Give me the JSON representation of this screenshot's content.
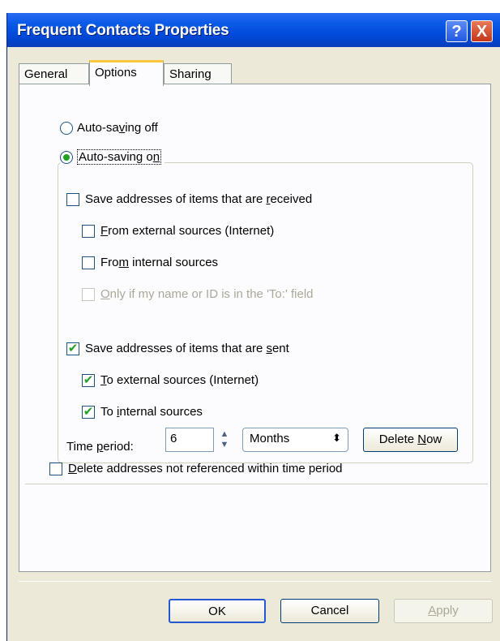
{
  "window": {
    "title": "Frequent Contacts Properties",
    "help_glyph": "?",
    "close_glyph": "X"
  },
  "tabs": [
    {
      "label": "General",
      "active": false
    },
    {
      "label": "Options",
      "active": true
    },
    {
      "label": "Sharing",
      "active": false
    }
  ],
  "options": {
    "auto_off": {
      "pre": "Auto-sa",
      "key": "v",
      "post": "ing off",
      "selected": false
    },
    "auto_on": {
      "pre": "Auto-saving o",
      "key": "n",
      "post": "",
      "selected": true
    },
    "received": {
      "pre": "Save addresses of items that are ",
      "key": "r",
      "post": "eceived",
      "checked": false
    },
    "recv_external": {
      "pre": "",
      "key": "F",
      "post": "rom external sources (Internet)",
      "checked": false
    },
    "recv_internal": {
      "pre": "Fro",
      "key": "m",
      "post": " internal sources",
      "checked": false
    },
    "only_if": {
      "pre": "",
      "key": "O",
      "post": "nly if my name or ID is in the 'To:' field",
      "checked": false,
      "disabled": true
    },
    "sent": {
      "pre": "Save addresses of items that are ",
      "key": "s",
      "post": "ent",
      "checked": true
    },
    "sent_external": {
      "pre": "",
      "key": "T",
      "post": "o external sources (Internet)",
      "checked": true
    },
    "sent_internal": {
      "pre": "To ",
      "key": "i",
      "post": "nternal sources",
      "checked": true
    },
    "delete_addresses": {
      "pre": "",
      "key": "D",
      "post": "elete addresses not referenced within time period",
      "checked": false
    }
  },
  "time_period": {
    "label_pre": "Time ",
    "label_key": "p",
    "label_post": "eriod:",
    "value": "6",
    "unit": "Months",
    "select_arrow": "⬍",
    "spin_up": "▲",
    "spin_down": "▼"
  },
  "buttons": {
    "delete_now_pre": "Delete ",
    "delete_now_key": "N",
    "delete_now_post": "ow",
    "ok": "OK",
    "cancel": "Cancel",
    "apply_key": "A",
    "apply_post": "pply"
  },
  "check_glyph": "✔"
}
